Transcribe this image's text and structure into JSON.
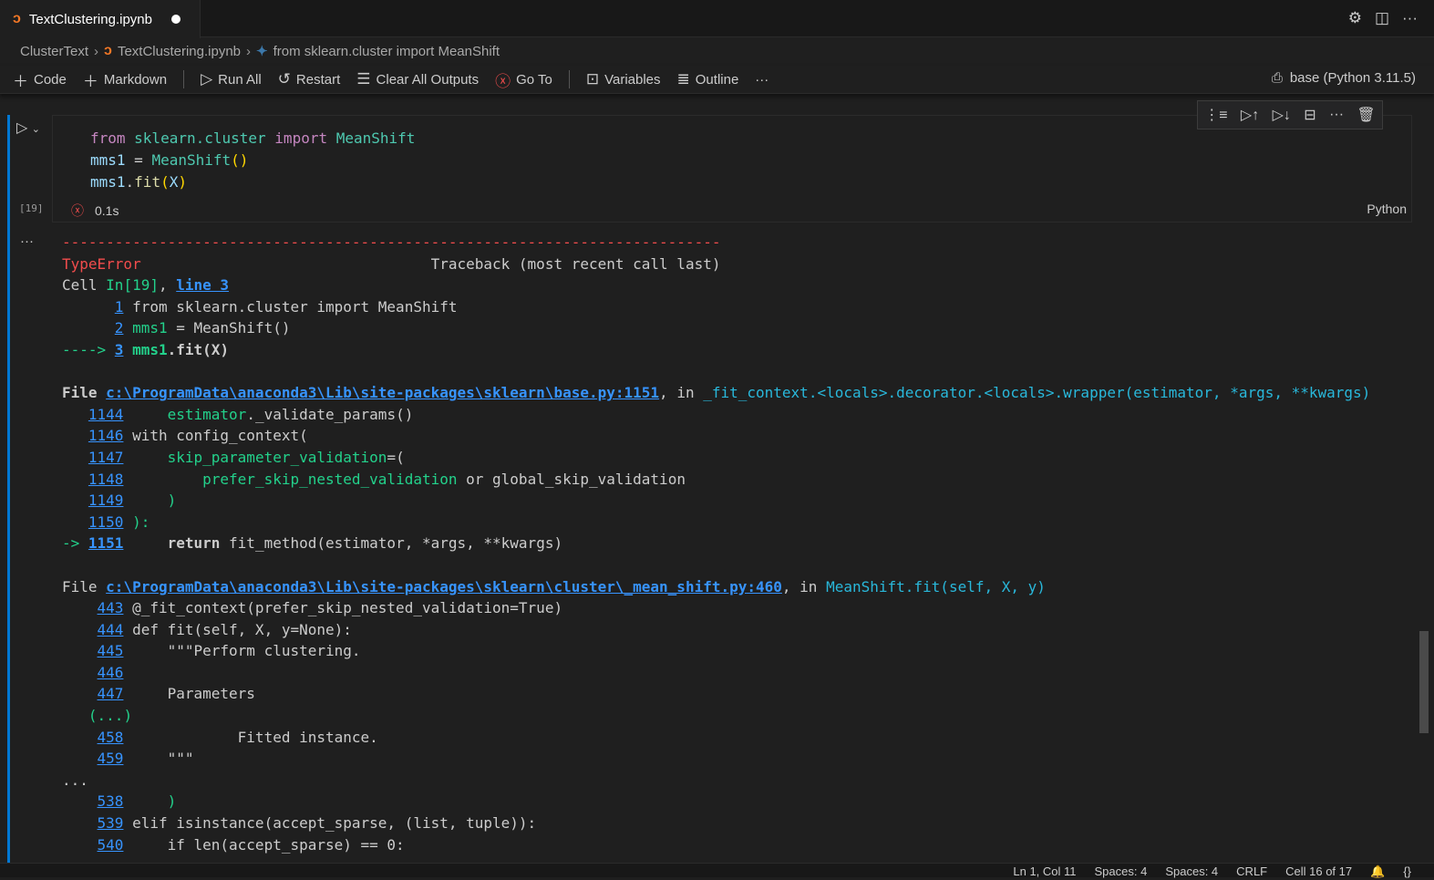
{
  "tab": {
    "title": "TextClustering.ipynb",
    "icon": "jupyter-icon"
  },
  "breadcrumb": [
    "ClusterText",
    "TextClustering.ipynb",
    "from sklearn.cluster import MeanShift"
  ],
  "toolbar": {
    "code": "Code",
    "markdown": "Markdown",
    "run_all": "Run All",
    "restart": "Restart",
    "clear": "Clear All Outputs",
    "goto": "Go To",
    "variables": "Variables",
    "outline": "Outline",
    "more": "···",
    "kernel": "base (Python 3.11.5)"
  },
  "cell": {
    "exec_count": "[19]",
    "time": "0.1s",
    "language": "Python",
    "code": [
      [
        [
          "from",
          "kw"
        ],
        [
          " sklearn.cluster ",
          "cls"
        ],
        [
          "import",
          "kw"
        ],
        [
          " MeanShift",
          "cls"
        ]
      ],
      [
        [
          "mms1",
          "var"
        ],
        [
          " = ",
          ""
        ],
        [
          "MeanShift",
          "cls"
        ],
        [
          "()",
          "par"
        ]
      ],
      [
        [
          "mms1",
          "var"
        ],
        [
          ".",
          ""
        ],
        [
          "fit",
          "fn"
        ],
        [
          "(",
          "par"
        ],
        [
          "X",
          "var"
        ],
        [
          ")",
          "par"
        ]
      ]
    ]
  },
  "output": [
    [
      [
        "---------------------------------------------------------------------------",
        "r"
      ]
    ],
    [
      [
        "TypeError",
        "r"
      ],
      [
        "                                 Traceback (most recent call last)",
        ""
      ]
    ],
    [
      [
        "Cell ",
        ""
      ],
      [
        "In[19]",
        "g"
      ],
      [
        ", ",
        ""
      ],
      [
        "line 3",
        "lb"
      ]
    ],
    [
      [
        "      ",
        ""
      ],
      [
        "1",
        "l"
      ],
      [
        " from sklearn.cluster import MeanShift",
        ""
      ]
    ],
    [
      [
        "      ",
        ""
      ],
      [
        "2",
        "l"
      ],
      [
        " ",
        ""
      ],
      [
        "mms1",
        "g"
      ],
      [
        " = MeanShift()",
        ""
      ]
    ],
    [
      [
        "----> ",
        "g"
      ],
      [
        "3",
        "lb"
      ],
      [
        " ",
        ""
      ],
      [
        "mms1",
        "gb"
      ],
      [
        ".fit(X)",
        "b"
      ]
    ],
    [],
    [
      [
        "File ",
        "b"
      ],
      [
        "c:\\ProgramData\\anaconda3\\Lib\\site-packages\\sklearn\\base.py:1151",
        "lb"
      ],
      [
        ", in ",
        ""
      ],
      [
        "_fit_context.<locals>.decorator.<locals>.wrapper(estimator, *args, **kwargs)",
        "c"
      ]
    ],
    [
      [
        "   ",
        ""
      ],
      [
        "1144",
        "l"
      ],
      [
        "     ",
        ""
      ],
      [
        "estimator",
        "g"
      ],
      [
        "._validate_params()",
        ""
      ]
    ],
    [
      [
        "   ",
        ""
      ],
      [
        "1146",
        "l"
      ],
      [
        " with config_context(",
        ""
      ]
    ],
    [
      [
        "   ",
        ""
      ],
      [
        "1147",
        "l"
      ],
      [
        "     ",
        ""
      ],
      [
        "skip_parameter_validation",
        "g"
      ],
      [
        "=(",
        ""
      ]
    ],
    [
      [
        "   ",
        ""
      ],
      [
        "1148",
        "l"
      ],
      [
        "         ",
        ""
      ],
      [
        "prefer_skip_nested_validation",
        "g"
      ],
      [
        " or global_skip_validation",
        ""
      ]
    ],
    [
      [
        "   ",
        ""
      ],
      [
        "1149",
        "l"
      ],
      [
        "     ",
        ""
      ],
      [
        ")",
        "g"
      ]
    ],
    [
      [
        "   ",
        ""
      ],
      [
        "1150",
        "l"
      ],
      [
        " ",
        ""
      ],
      [
        "):",
        "g"
      ]
    ],
    [
      [
        "-> ",
        "g"
      ],
      [
        "1151",
        "lb"
      ],
      [
        "     ",
        ""
      ],
      [
        "return",
        "b"
      ],
      [
        " fit_method(estimator, *args, **kwargs)",
        ""
      ]
    ],
    [],
    [
      [
        "File ",
        ""
      ],
      [
        "c:\\ProgramData\\anaconda3\\Lib\\site-packages\\sklearn\\cluster\\_mean_shift.py:460",
        "lb"
      ],
      [
        ", in ",
        ""
      ],
      [
        "MeanShift.fit(self, X, y)",
        "c"
      ]
    ],
    [
      [
        "    ",
        ""
      ],
      [
        "443",
        "l"
      ],
      [
        " @_fit_context(prefer_skip_nested_validation=True)",
        ""
      ]
    ],
    [
      [
        "    ",
        ""
      ],
      [
        "444",
        "l"
      ],
      [
        " def fit(self, X, y=None):",
        ""
      ]
    ],
    [
      [
        "    ",
        ""
      ],
      [
        "445",
        "l"
      ],
      [
        "     \"\"\"Perform clustering.",
        ""
      ]
    ],
    [
      [
        "    ",
        ""
      ],
      [
        "446",
        "l"
      ]
    ],
    [
      [
        "    ",
        ""
      ],
      [
        "447",
        "l"
      ],
      [
        "     Parameters",
        ""
      ]
    ],
    [
      [
        "   ",
        ""
      ],
      [
        "(...)",
        "g"
      ]
    ],
    [
      [
        "    ",
        ""
      ],
      [
        "458",
        "l"
      ],
      [
        "             Fitted instance.",
        ""
      ]
    ],
    [
      [
        "    ",
        ""
      ],
      [
        "459",
        "l"
      ],
      [
        "     \"\"\"",
        ""
      ]
    ],
    [
      [
        "...",
        ""
      ]
    ],
    [
      [
        "    ",
        ""
      ],
      [
        "538",
        "l"
      ],
      [
        "     ",
        ""
      ],
      [
        ")",
        "g"
      ]
    ],
    [
      [
        "    ",
        ""
      ],
      [
        "539",
        "l"
      ],
      [
        " elif isinstance(accept_sparse, (list, tuple)):",
        ""
      ]
    ],
    [
      [
        "    ",
        ""
      ],
      [
        "540",
        "l"
      ],
      [
        "     if len(accept_sparse) == 0:",
        ""
      ]
    ]
  ],
  "statusbar": [
    "Ln 1, Col 11",
    "Spaces: 4",
    "Spaces: 4",
    "CRLF",
    "Cell 16 of 17"
  ]
}
